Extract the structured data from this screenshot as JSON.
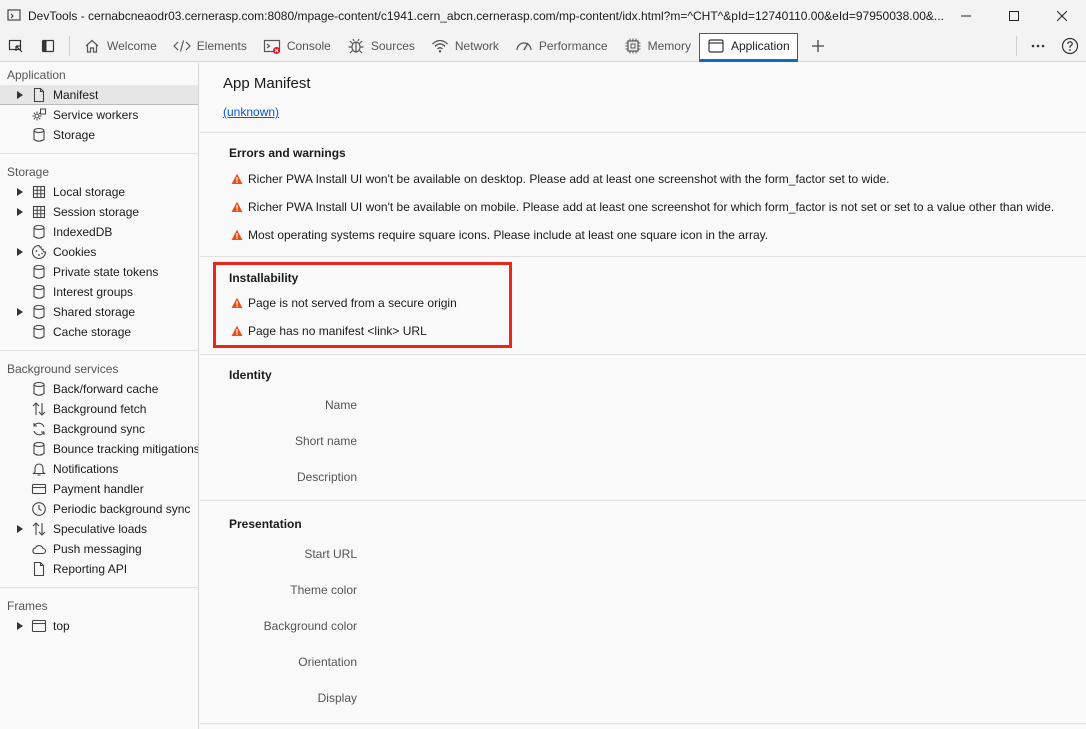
{
  "window": {
    "title": "DevTools - cernabcneaodr03.cernerasp.com:8080/mpage-content/c1941.cern_abcn.cernerasp.com/mp-content/idx.html?m=^CHT^&pId=12740110.00&eId=97950038.00&..."
  },
  "toolbar": {
    "tabs": [
      {
        "label": "Welcome",
        "icon": "home-icon"
      },
      {
        "label": "Elements",
        "icon": "code-icon"
      },
      {
        "label": "Console",
        "icon": "console-icon"
      },
      {
        "label": "Sources",
        "icon": "bug-icon"
      },
      {
        "label": "Network",
        "icon": "wifi-icon"
      },
      {
        "label": "Performance",
        "icon": "performance-icon"
      },
      {
        "label": "Memory",
        "icon": "memory-icon"
      },
      {
        "label": "Application",
        "icon": "application-icon"
      }
    ]
  },
  "sidebar": {
    "application": {
      "title": "Application",
      "items": [
        {
          "label": "Manifest",
          "icon": "document-icon",
          "expandable": true,
          "selected": true
        },
        {
          "label": "Service workers",
          "icon": "gear-icon",
          "expandable": false
        },
        {
          "label": "Storage",
          "icon": "database-icon",
          "expandable": false
        }
      ]
    },
    "storage": {
      "title": "Storage",
      "items": [
        {
          "label": "Local storage",
          "icon": "grid-icon",
          "expandable": true
        },
        {
          "label": "Session storage",
          "icon": "grid-icon",
          "expandable": true
        },
        {
          "label": "IndexedDB",
          "icon": "database-icon",
          "expandable": false
        },
        {
          "label": "Cookies",
          "icon": "cookie-icon",
          "expandable": true
        },
        {
          "label": "Private state tokens",
          "icon": "database-icon",
          "expandable": false
        },
        {
          "label": "Interest groups",
          "icon": "database-icon",
          "expandable": false
        },
        {
          "label": "Shared storage",
          "icon": "database-icon",
          "expandable": true
        },
        {
          "label": "Cache storage",
          "icon": "database-icon",
          "expandable": false
        }
      ]
    },
    "background": {
      "title": "Background services",
      "items": [
        {
          "label": "Back/forward cache",
          "icon": "database-icon",
          "expandable": false
        },
        {
          "label": "Background fetch",
          "icon": "arrows-up-down-icon",
          "expandable": false
        },
        {
          "label": "Background sync",
          "icon": "sync-icon",
          "expandable": false
        },
        {
          "label": "Bounce tracking mitigations",
          "icon": "database-icon",
          "expandable": false
        },
        {
          "label": "Notifications",
          "icon": "bell-icon",
          "expandable": false
        },
        {
          "label": "Payment handler",
          "icon": "card-icon",
          "expandable": false
        },
        {
          "label": "Periodic background sync",
          "icon": "clock-icon",
          "expandable": false
        },
        {
          "label": "Speculative loads",
          "icon": "arrows-up-down-icon",
          "expandable": true
        },
        {
          "label": "Push messaging",
          "icon": "cloud-icon",
          "expandable": false
        },
        {
          "label": "Reporting API",
          "icon": "document-icon",
          "expandable": false
        }
      ]
    },
    "frames": {
      "title": "Frames",
      "items": [
        {
          "label": "top",
          "icon": "window-icon",
          "expandable": true
        }
      ]
    }
  },
  "main": {
    "title": "App Manifest",
    "link": "(unknown)",
    "errors": {
      "heading": "Errors and warnings",
      "items": [
        "Richer PWA Install UI won't be available on desktop. Please add at least one screenshot with the form_factor set to wide.",
        "Richer PWA Install UI won't be available on mobile. Please add at least one screenshot for which form_factor is not set or set to a value other than wide.",
        "Most operating systems require square icons. Please include at least one square icon in the array."
      ]
    },
    "installability": {
      "heading": "Installability",
      "items": [
        "Page is not served from a secure origin",
        "Page has no manifest <link> URL"
      ]
    },
    "identity": {
      "heading": "Identity",
      "fields": [
        "Name",
        "Short name",
        "Description"
      ]
    },
    "presentation": {
      "heading": "Presentation",
      "fields": [
        "Start URL",
        "Theme color",
        "Background color",
        "Orientation",
        "Display"
      ]
    }
  },
  "colors": {
    "accent": "#0f6cbd",
    "warning": "#e8501a",
    "highlight": "#e8261a",
    "link": "#0b57d0"
  }
}
